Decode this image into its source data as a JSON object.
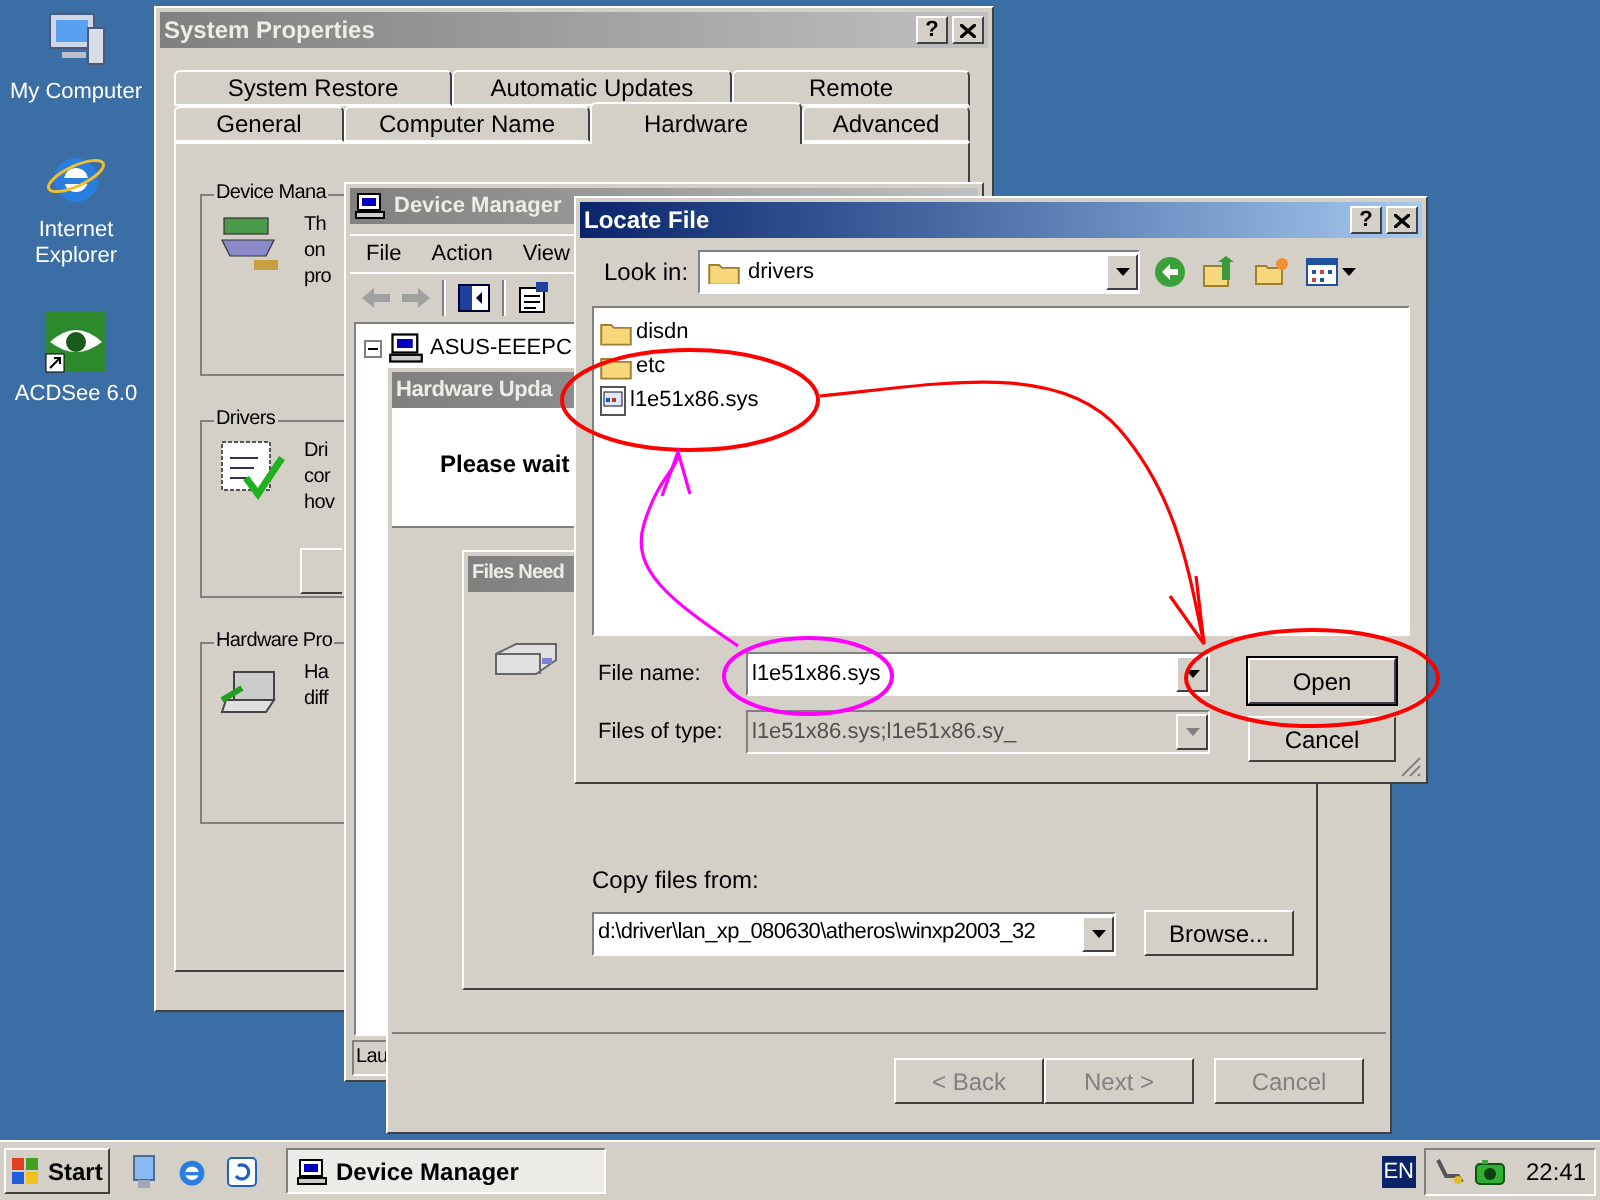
{
  "desktop_icons": [
    {
      "label": "My Computer"
    },
    {
      "label": "Internet Explorer"
    },
    {
      "label": "ACDSee 6.0"
    }
  ],
  "system_properties": {
    "title": "System Properties",
    "active": false,
    "help": "?",
    "tabs_back": [
      {
        "label": "System Restore",
        "selected": false
      },
      {
        "label": "Automatic Updates",
        "selected": false
      },
      {
        "label": "Remote",
        "selected": false
      }
    ],
    "tabs_front": [
      {
        "label": "General",
        "selected": false
      },
      {
        "label": "Computer Name",
        "selected": false
      },
      {
        "label": "Hardware",
        "selected": true
      },
      {
        "label": "Advanced",
        "selected": false
      }
    ],
    "groups": [
      {
        "title": "Device Mana",
        "lines": [
          "Th",
          "on",
          "pro"
        ]
      },
      {
        "title": "Drivers",
        "lines": [
          "Dri",
          "cor",
          "hov"
        ]
      },
      {
        "title": "Hardware Pro",
        "lines": [
          "Ha",
          "diff"
        ]
      }
    ]
  },
  "device_manager": {
    "title": "Device Manager",
    "active": false,
    "menu": [
      "File",
      "Action",
      "View"
    ],
    "tree": [
      {
        "label": "ASUS-EEEPC",
        "expanded": true
      }
    ],
    "status": "Lau"
  },
  "wizard": {
    "title": "Hardware Upda",
    "active": false,
    "message": "Please wait",
    "buttons": [
      {
        "label": "< Back",
        "disabled": true
      },
      {
        "label": "Next >",
        "disabled": true
      },
      {
        "label": "Cancel",
        "disabled": true
      }
    ]
  },
  "files_needed": {
    "title": "Files Need",
    "active": false,
    "copy_label": "Copy files from:",
    "path": "d:\\driver\\lan_xp_080630\\atheros\\winxp2003_32",
    "browse": "Browse..."
  },
  "locate_file": {
    "title": "Locate File",
    "active": true,
    "help": "?",
    "look_in_label": "Look in:",
    "look_in": "drivers",
    "files": [
      {
        "name": "disdn",
        "kind": "folder"
      },
      {
        "name": "etc",
        "kind": "folder"
      },
      {
        "name": "l1e51x86.sys",
        "kind": "file"
      }
    ],
    "file_name_label": "File name:",
    "file_name": "l1e51x86.sys",
    "type_label": "Files of type:",
    "type_value": "l1e51x86.sys;l1e51x86.sy_",
    "type_disabled": true,
    "buttons": [
      {
        "label": "Open",
        "default": true
      },
      {
        "label": "Cancel",
        "default": false
      }
    ]
  },
  "taskbar": {
    "start": "Start",
    "tasks": [
      {
        "label": "Device Manager",
        "selected": true
      }
    ],
    "language": "EN",
    "clock": "22:41"
  }
}
